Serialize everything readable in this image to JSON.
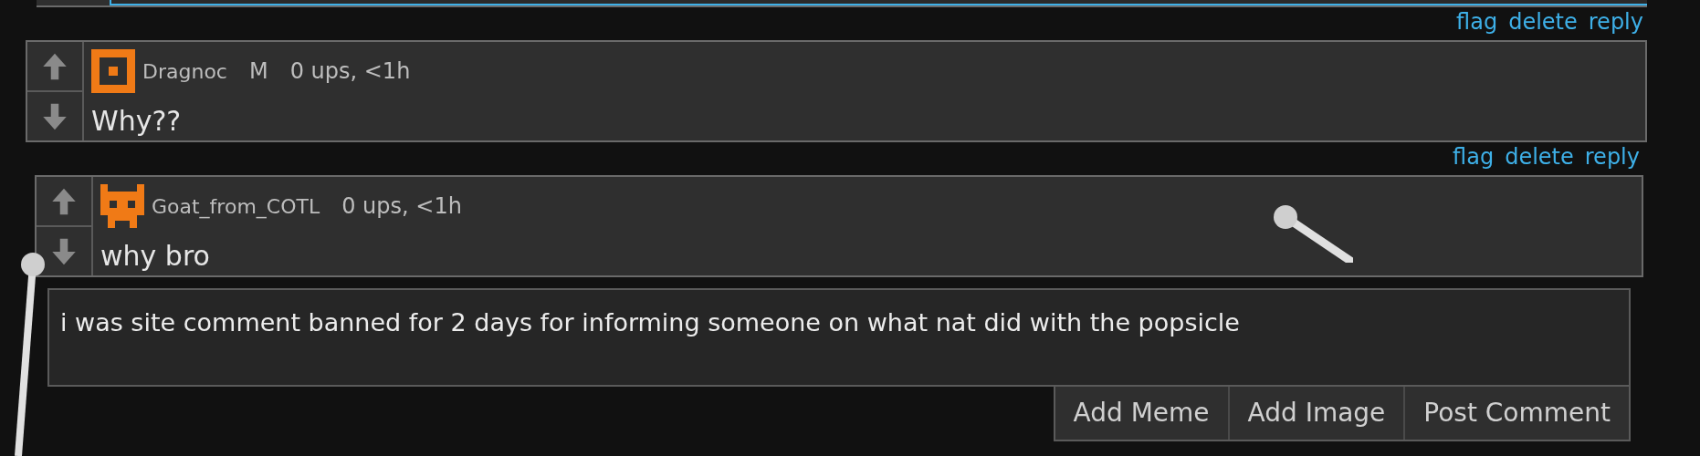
{
  "comments": [
    {
      "actions": [
        "flag",
        "delete",
        "reply"
      ],
      "author": "Dragnoc",
      "badge": "M",
      "meta": "0 ups, <1h",
      "text": "Why??",
      "kind": "square"
    },
    {
      "actions": [
        "flag",
        "delete",
        "reply"
      ],
      "author": "Goat_from_COTL",
      "meta": "0 ups, <1h",
      "text": "why bro",
      "kind": "creature"
    }
  ],
  "reply_box": {
    "value": "i was site comment banned for 2 days for informing someone on what nat did with the popsicle"
  },
  "buttons": [
    "Add Meme",
    "Add Image",
    "Post Comment"
  ]
}
